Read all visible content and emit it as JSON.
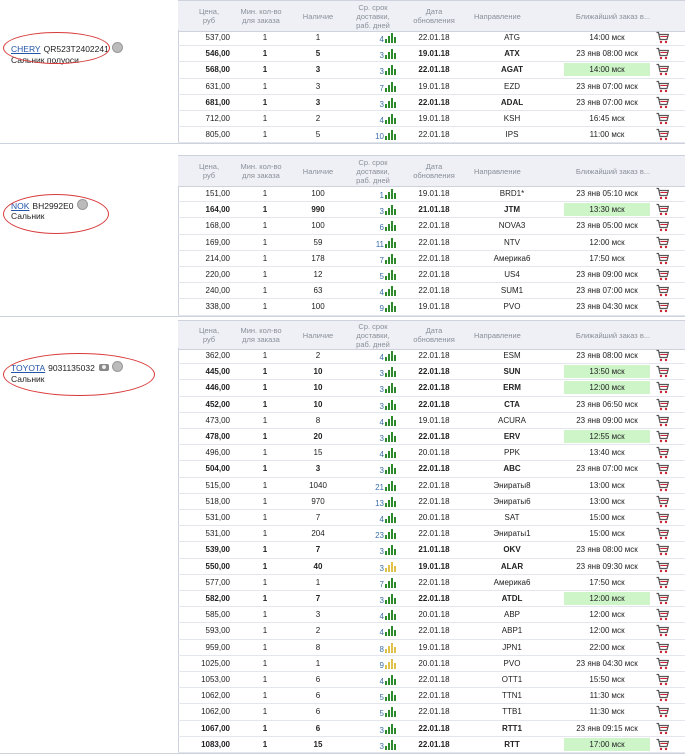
{
  "columns": {
    "price": "Цена,\nруб",
    "min": "Мин. кол-во\nдля заказа",
    "stock": "Наличие",
    "days": "Ср. срок\nдоставки,\nраб. дней",
    "date": "Дата\nобновления",
    "direction": "Направление",
    "eta": "Ближайший заказ в..."
  },
  "groups": [
    {
      "brand": "CHERY",
      "part_number": "QR523T2402241",
      "description": "Сальник полуоси",
      "has_camera": false,
      "rows": [
        {
          "price": "537,00",
          "min": "1",
          "stock": "1",
          "days": "4",
          "date": "22.01.18",
          "dir": "ATG",
          "eta": "14:00 мск",
          "bold": false,
          "green": false,
          "yellow": false
        },
        {
          "price": "546,00",
          "min": "1",
          "stock": "5",
          "days": "3",
          "date": "19.01.18",
          "dir": "ATX",
          "eta": "23 янв 08:00 мск",
          "bold": true,
          "green": false,
          "yellow": false
        },
        {
          "price": "568,00",
          "min": "1",
          "stock": "3",
          "days": "3",
          "date": "22.01.18",
          "dir": "AGAT",
          "eta": "14:00 мск",
          "bold": true,
          "green": true,
          "yellow": false
        },
        {
          "price": "631,00",
          "min": "1",
          "stock": "3",
          "days": "7",
          "date": "19.01.18",
          "dir": "EZD",
          "eta": "23 янв 07:00 мск",
          "bold": false,
          "green": false,
          "yellow": false
        },
        {
          "price": "681,00",
          "min": "1",
          "stock": "3",
          "days": "3",
          "date": "22.01.18",
          "dir": "ADAL",
          "eta": "23 янв 07:00 мск",
          "bold": true,
          "green": false,
          "yellow": false
        },
        {
          "price": "712,00",
          "min": "1",
          "stock": "2",
          "days": "4",
          "date": "19.01.18",
          "dir": "KSH",
          "eta": "16:45 мск",
          "bold": false,
          "green": false,
          "yellow": false
        },
        {
          "price": "805,00",
          "min": "1",
          "stock": "5",
          "days": "10",
          "date": "22.01.18",
          "dir": "IPS",
          "eta": "11:00 мск",
          "bold": false,
          "green": false,
          "yellow": false
        }
      ]
    },
    {
      "brand": "NOK",
      "part_number": "BH2992E0",
      "description": "Сальник",
      "has_camera": false,
      "rows": [
        {
          "price": "151,00",
          "min": "1",
          "stock": "100",
          "days": "1",
          "date": "19.01.18",
          "dir": "BRD1*",
          "eta": "23 янв 05:10 мск",
          "bold": false,
          "green": false,
          "yellow": false
        },
        {
          "price": "164,00",
          "min": "1",
          "stock": "990",
          "days": "3",
          "date": "21.01.18",
          "dir": "JTM",
          "eta": "13:30 мск",
          "bold": true,
          "green": true,
          "yellow": false
        },
        {
          "price": "168,00",
          "min": "1",
          "stock": "100",
          "days": "6",
          "date": "22.01.18",
          "dir": "NOVA3",
          "eta": "23 янв 05:00 мск",
          "bold": false,
          "green": false,
          "yellow": false
        },
        {
          "price": "169,00",
          "min": "1",
          "stock": "59",
          "days": "11",
          "date": "22.01.18",
          "dir": "NTV",
          "eta": "12:00 мск",
          "bold": false,
          "green": false,
          "yellow": false
        },
        {
          "price": "214,00",
          "min": "1",
          "stock": "178",
          "days": "7",
          "date": "22.01.18",
          "dir": "Америка6",
          "eta": "17:50 мск",
          "bold": false,
          "green": false,
          "yellow": false
        },
        {
          "price": "220,00",
          "min": "1",
          "stock": "12",
          "days": "5",
          "date": "22.01.18",
          "dir": "US4",
          "eta": "23 янв 09:00 мск",
          "bold": false,
          "green": false,
          "yellow": false
        },
        {
          "price": "240,00",
          "min": "1",
          "stock": "63",
          "days": "4",
          "date": "22.01.18",
          "dir": "SUM1",
          "eta": "23 янв 07:00 мск",
          "bold": false,
          "green": false,
          "yellow": false
        },
        {
          "price": "338,00",
          "min": "1",
          "stock": "100",
          "days": "9",
          "date": "19.01.18",
          "dir": "PVO",
          "eta": "23 янв 04:30 мск",
          "bold": false,
          "green": false,
          "yellow": false
        }
      ]
    },
    {
      "brand": "TOYOTA",
      "part_number": "9031135032",
      "description": "Сальник",
      "has_camera": true,
      "rows": [
        {
          "price": "362,00",
          "min": "1",
          "stock": "2",
          "days": "4",
          "date": "22.01.18",
          "dir": "ESM",
          "eta": "23 янв 08:00 мск",
          "bold": false,
          "green": false,
          "yellow": false
        },
        {
          "price": "445,00",
          "min": "1",
          "stock": "10",
          "days": "3",
          "date": "22.01.18",
          "dir": "SUN",
          "eta": "13:50 мск",
          "bold": true,
          "green": true,
          "yellow": false
        },
        {
          "price": "446,00",
          "min": "1",
          "stock": "10",
          "days": "3",
          "date": "22.01.18",
          "dir": "ERM",
          "eta": "12:00 мск",
          "bold": true,
          "green": true,
          "yellow": false
        },
        {
          "price": "452,00",
          "min": "1",
          "stock": "10",
          "days": "3",
          "date": "22.01.18",
          "dir": "CTA",
          "eta": "23 янв 06:50 мск",
          "bold": true,
          "green": false,
          "yellow": false
        },
        {
          "price": "473,00",
          "min": "1",
          "stock": "8",
          "days": "4",
          "date": "19.01.18",
          "dir": "ACURA",
          "eta": "23 янв 09:00 мск",
          "bold": false,
          "green": false,
          "yellow": false
        },
        {
          "price": "478,00",
          "min": "1",
          "stock": "20",
          "days": "3",
          "date": "22.01.18",
          "dir": "ERV",
          "eta": "12:55 мск",
          "bold": true,
          "green": true,
          "yellow": false
        },
        {
          "price": "496,00",
          "min": "1",
          "stock": "15",
          "days": "4",
          "date": "20.01.18",
          "dir": "PPK",
          "eta": "13:40 мск",
          "bold": false,
          "green": false,
          "yellow": false
        },
        {
          "price": "504,00",
          "min": "1",
          "stock": "3",
          "days": "3",
          "date": "22.01.18",
          "dir": "ABC",
          "eta": "23 янв 07:00 мск",
          "bold": true,
          "green": false,
          "yellow": false
        },
        {
          "price": "515,00",
          "min": "1",
          "stock": "1040",
          "days": "21",
          "date": "22.01.18",
          "dir": "Энираты8",
          "eta": "13:00 мск",
          "bold": false,
          "green": false,
          "yellow": false
        },
        {
          "price": "518,00",
          "min": "1",
          "stock": "970",
          "days": "13",
          "date": "22.01.18",
          "dir": "Энираты6",
          "eta": "13:00 мск",
          "bold": false,
          "green": false,
          "yellow": false
        },
        {
          "price": "531,00",
          "min": "1",
          "stock": "7",
          "days": "4",
          "date": "20.01.18",
          "dir": "SAT",
          "eta": "15:00 мск",
          "bold": false,
          "green": false,
          "yellow": false
        },
        {
          "price": "531,00",
          "min": "1",
          "stock": "204",
          "days": "23",
          "date": "22.01.18",
          "dir": "Энираты1",
          "eta": "15:00 мск",
          "bold": false,
          "green": false,
          "yellow": false
        },
        {
          "price": "539,00",
          "min": "1",
          "stock": "7",
          "days": "3",
          "date": "21.01.18",
          "dir": "OKV",
          "eta": "23 янв 08:00 мск",
          "bold": true,
          "green": false,
          "yellow": false
        },
        {
          "price": "550,00",
          "min": "1",
          "stock": "40",
          "days": "3",
          "date": "19.01.18",
          "dir": "ALAR",
          "eta": "23 янв 09:30 мск",
          "bold": true,
          "green": false,
          "yellow": true
        },
        {
          "price": "577,00",
          "min": "1",
          "stock": "1",
          "days": "7",
          "date": "22.01.18",
          "dir": "Америка6",
          "eta": "17:50 мск",
          "bold": false,
          "green": false,
          "yellow": false
        },
        {
          "price": "582,00",
          "min": "1",
          "stock": "7",
          "days": "3",
          "date": "22.01.18",
          "dir": "ATDL",
          "eta": "12:00 мск",
          "bold": true,
          "green": true,
          "yellow": false
        },
        {
          "price": "585,00",
          "min": "1",
          "stock": "3",
          "days": "4",
          "date": "20.01.18",
          "dir": "ABP",
          "eta": "12:00 мск",
          "bold": false,
          "green": false,
          "yellow": false
        },
        {
          "price": "593,00",
          "min": "1",
          "stock": "2",
          "days": "4",
          "date": "22.01.18",
          "dir": "ABP1",
          "eta": "12:00 мск",
          "bold": false,
          "green": false,
          "yellow": false
        },
        {
          "price": "959,00",
          "min": "1",
          "stock": "8",
          "days": "8",
          "date": "19.01.18",
          "dir": "JPN1",
          "eta": "22:00 мск",
          "bold": false,
          "green": false,
          "yellow": true
        },
        {
          "price": "1025,00",
          "min": "1",
          "stock": "1",
          "days": "9",
          "date": "20.01.18",
          "dir": "PVO",
          "eta": "23 янв 04:30 мск",
          "bold": false,
          "green": false,
          "yellow": true
        },
        {
          "price": "1053,00",
          "min": "1",
          "stock": "6",
          "days": "4",
          "date": "22.01.18",
          "dir": "OTT1",
          "eta": "15:50 мск",
          "bold": false,
          "green": false,
          "yellow": false
        },
        {
          "price": "1062,00",
          "min": "1",
          "stock": "6",
          "days": "5",
          "date": "22.01.18",
          "dir": "TTN1",
          "eta": "11:30 мск",
          "bold": false,
          "green": false,
          "yellow": false
        },
        {
          "price": "1062,00",
          "min": "1",
          "stock": "6",
          "days": "5",
          "date": "22.01.18",
          "dir": "TTB1",
          "eta": "11:30 мск",
          "bold": false,
          "green": false,
          "yellow": false
        },
        {
          "price": "1067,00",
          "min": "1",
          "stock": "6",
          "days": "3",
          "date": "22.01.18",
          "dir": "RTT1",
          "eta": "23 янв 09:15 мск",
          "bold": true,
          "green": false,
          "yellow": false
        },
        {
          "price": "1083,00",
          "min": "1",
          "stock": "15",
          "days": "3",
          "date": "22.01.18",
          "dir": "RTT",
          "eta": "17:00 мск",
          "bold": true,
          "green": true,
          "yellow": false
        }
      ]
    }
  ]
}
